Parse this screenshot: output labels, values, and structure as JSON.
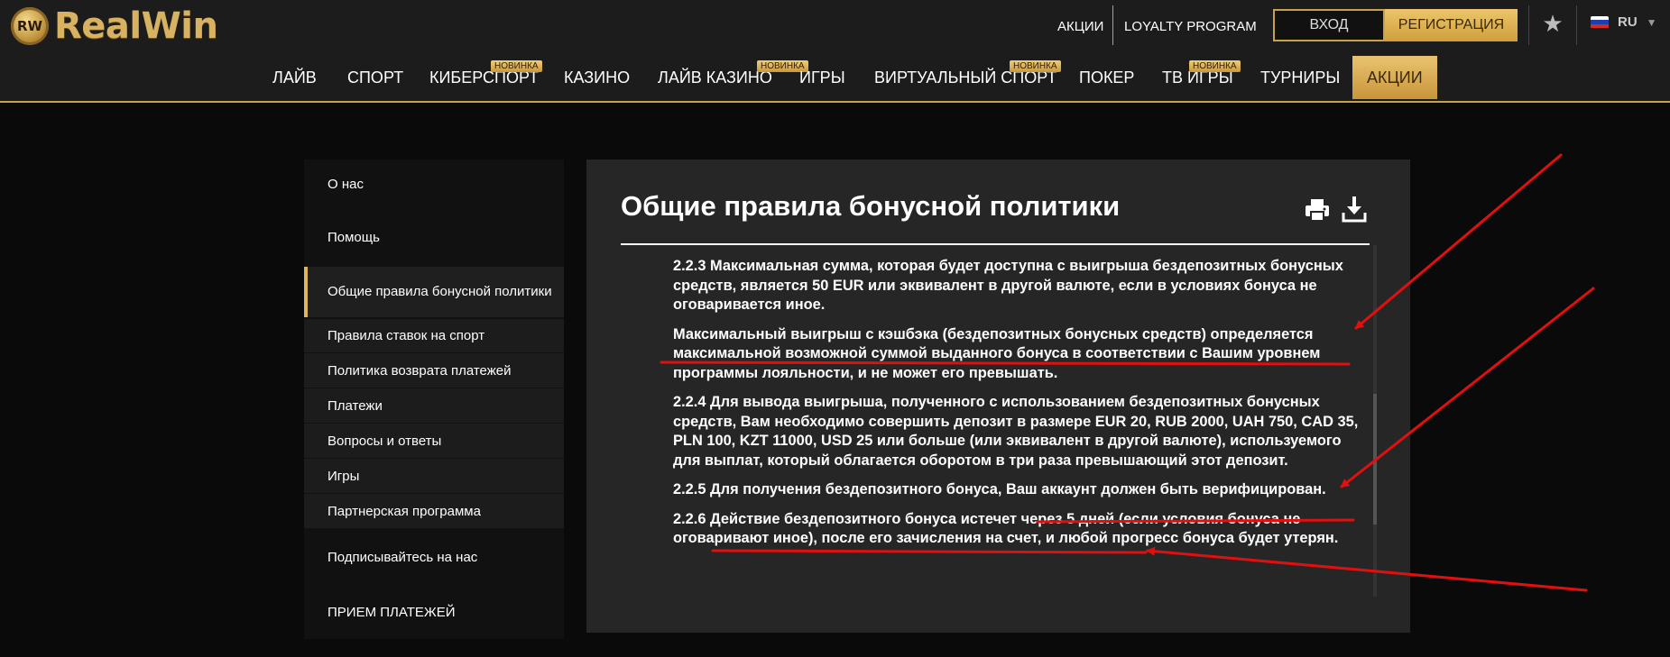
{
  "brand": {
    "logo_badge": "RW",
    "name": "RealWin"
  },
  "topbar": {
    "promo_link": "АКЦИИ",
    "loyalty_link": "LOYALTY PROGRAM",
    "login_label": "ВХОД",
    "register_label": "РЕГИСТРАЦИЯ",
    "language": "RU",
    "icons": [
      "star-icon",
      "flag-ru-icon",
      "chevron-down-icon"
    ]
  },
  "nav": {
    "items": [
      {
        "label": "ЛАЙВ"
      },
      {
        "label": "СПОРТ"
      },
      {
        "label": "КИБЕРСПОРТ",
        "badge": "НОВИНКА"
      },
      {
        "label": "КАЗИНО"
      },
      {
        "label": "ЛАЙВ КАЗИНО",
        "badge": "НОВИНКА"
      },
      {
        "label": "ИГРЫ"
      },
      {
        "label": "ВИРТУАЛЬНЫЙ СПОРТ",
        "badge": "НОВИНКА"
      },
      {
        "label": "ПОКЕР"
      },
      {
        "label": "ТВ ИГРЫ",
        "badge": "НОВИНКА"
      },
      {
        "label": "ТУРНИРЫ"
      },
      {
        "label": "АКЦИИ",
        "active": true
      }
    ]
  },
  "sidebar": {
    "items": [
      {
        "label": "О нас"
      },
      {
        "label": "Помощь"
      },
      {
        "label": "Общие правила бонусной политики",
        "active": true
      },
      {
        "label": "Правила ставок на спорт"
      },
      {
        "label": "Политика возврата платежей"
      },
      {
        "label": "Платежи"
      },
      {
        "label": "Вопросы и ответы"
      },
      {
        "label": "Игры"
      },
      {
        "label": "Партнерская программа"
      },
      {
        "label": "Подписывайтесь на нас"
      },
      {
        "label": "ПРИЕМ ПЛАТЕЖЕЙ"
      }
    ]
  },
  "main": {
    "title": "Общие правила бонусной политики",
    "icons": [
      "print-icon",
      "download-icon"
    ],
    "paragraphs": [
      "2.2.3 Максимальная сумма, которая будет доступна с выигрыша бездепозитных бонусных средств, является 50 EUR или эквивалент в другой валюте, если в условиях бонуса не оговаривается иное.",
      "Максимальный выигрыш с кэшбэка (бездепозитных бонусных средств) определяется максимальной возможной суммой выданного бонуса в соответствии с Вашим уровнем программы лояльности, и не может его превышать.",
      "2.2.4 Для вывода выигрыша, полученного с использованием бездепозитных бонусных средств, Вам необходимо совершить депозит в размере EUR 20, RUB 2000, UAH 750, CAD 35, PLN 100, KZT 11000, USD 25 или больше (или эквивалент в другой валюте), используемого для выплат, который облагается оборотом в три раза превышающий этот депозит.",
      "2.2.5 Для получения бездепозитного бонуса, Ваш аккаунт должен быть верифицирован.",
      "2.2.6 Действие бездепозитного бонуса истечет через 5 дней (если условия бонуса не оговаривают иное), после его зачисления на счет, и любой прогресс бонуса будет утерян."
    ]
  },
  "colors": {
    "accent_gold": "#c8a24a",
    "annotation_red": "#e01010",
    "page_bg": "#0a0a0a",
    "panel_bg": "#262626"
  }
}
